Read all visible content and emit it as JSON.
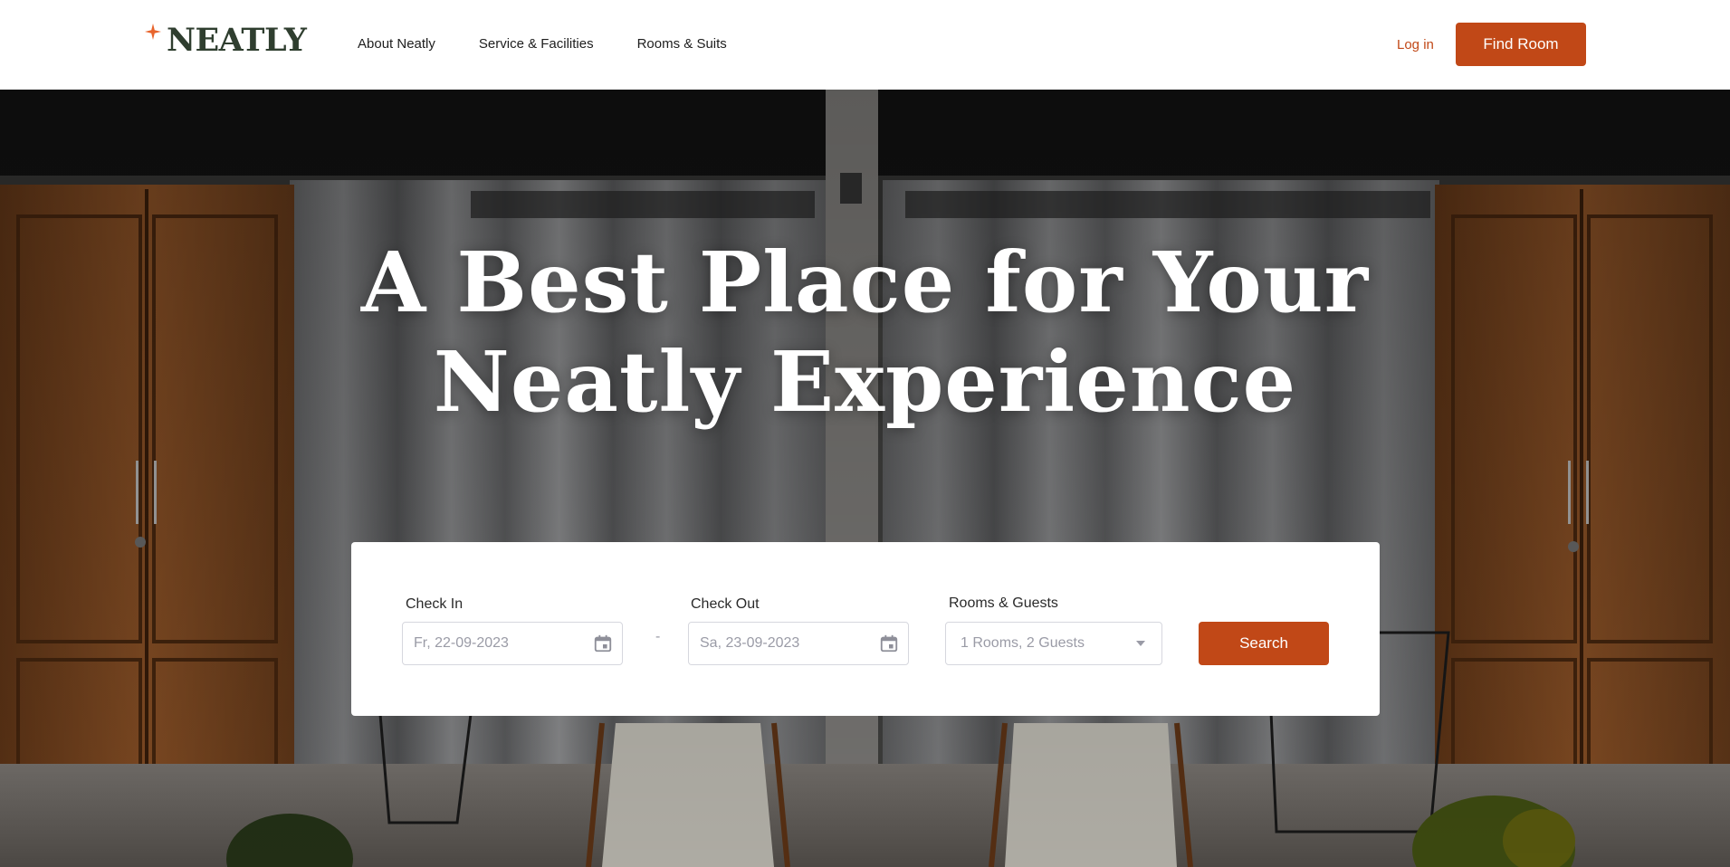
{
  "brand": {
    "name": "NEATLY",
    "accent": "#c14817",
    "dark": "#2f3e2f"
  },
  "nav": {
    "links": [
      "About Neatly",
      "Service & Facilities",
      "Rooms & Suits"
    ],
    "login_label": "Log in",
    "cta_label": "Find Room"
  },
  "hero": {
    "title_line1": "A Best Place for Your",
    "title_line2": "Neatly Experience"
  },
  "search": {
    "checkin_label": "Check In",
    "checkin_value": "Fr, 22-09-2023",
    "separator": "-",
    "checkout_label": "Check Out",
    "checkout_value": "Sa, 23-09-2023",
    "guests_label": "Rooms & Guests",
    "guests_value": "1 Rooms, 2 Guests",
    "button_label": "Search"
  },
  "icons": {
    "logo": "sparkle-star-icon",
    "date": "calendar-icon",
    "dropdown": "chevron-down-icon"
  }
}
